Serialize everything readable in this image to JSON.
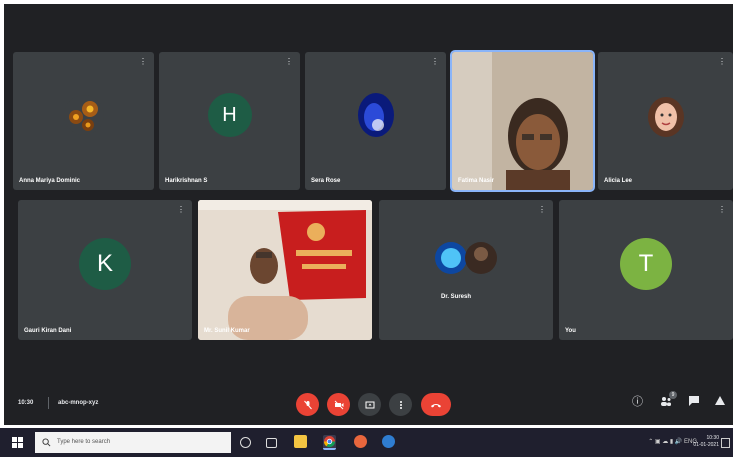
{
  "participants_row1": [
    {
      "name": "Anna Mariya Dominic",
      "avatar": "sunflower-photo"
    },
    {
      "name": "Harikrishnan S",
      "initial": "H",
      "color": "#1e5c45"
    },
    {
      "name": "Sera Rose",
      "avatar": "blue-abstract-photo"
    },
    {
      "name": "Fatima Nasir",
      "avatar": "video-feed",
      "active": true
    },
    {
      "name": "Alicia Lee",
      "avatar": "profile-photo"
    }
  ],
  "participants_row2": [
    {
      "name": "Gauri Kiran Dani",
      "initial": "K",
      "color": "#1e5c45"
    },
    {
      "name": "Mr. Sunil Kumar",
      "avatar": "video-feed"
    },
    {
      "name": "Dr. Suresh",
      "avatar": "two-photos"
    },
    {
      "name": "You",
      "initial": "T",
      "color": "#7cb342"
    }
  ],
  "meeting": {
    "time": "10:30",
    "code": "abc-mnop-xyz"
  },
  "controls": {
    "mic_icon": "mic-off",
    "cam_icon": "cam-off",
    "present_icon": "present",
    "more_icon": "more-vert",
    "end_icon": "end-call"
  },
  "taskbar": {
    "search_placeholder": "Type here to search",
    "clock_time": "10:30",
    "clock_date": "01-01-2021"
  }
}
